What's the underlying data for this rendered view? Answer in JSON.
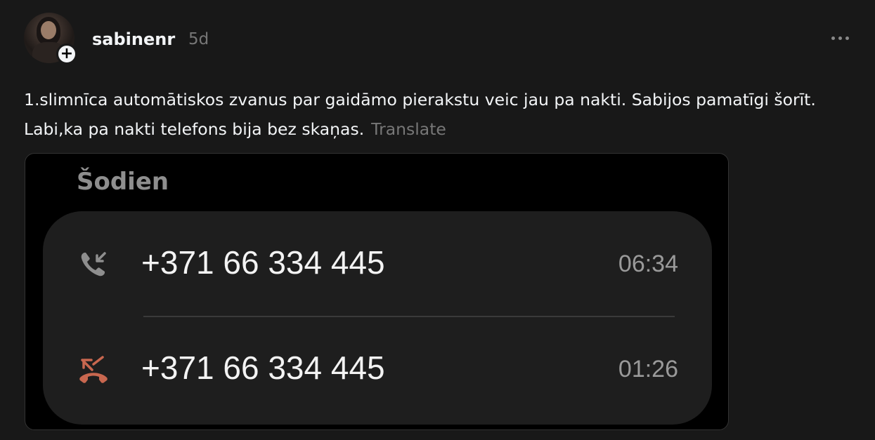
{
  "post": {
    "author": "sabinenr",
    "time_ago": "5d",
    "text": "1.slimnīca automātiskos zvanus par gaidāmo pierakstu veic jau pa nakti. Sabijos pamatīgi šorīt. Labi,ka pa nakti telefons bija bez skaņas.",
    "translate_label": "Translate",
    "follow_symbol": "+"
  },
  "screenshot": {
    "section_title": "Šodien",
    "calls": [
      {
        "icon": "incoming-call-icon",
        "number": "+371 66 334 445",
        "time": "06:34",
        "color": "#8e8e8e"
      },
      {
        "icon": "missed-call-icon",
        "number": "+371 66 334 445",
        "time": "01:26",
        "color": "#c8674f"
      }
    ]
  },
  "colors": {
    "background": "#181818",
    "text": "#f3f5f7",
    "muted": "#777777",
    "missed": "#c8674f"
  }
}
